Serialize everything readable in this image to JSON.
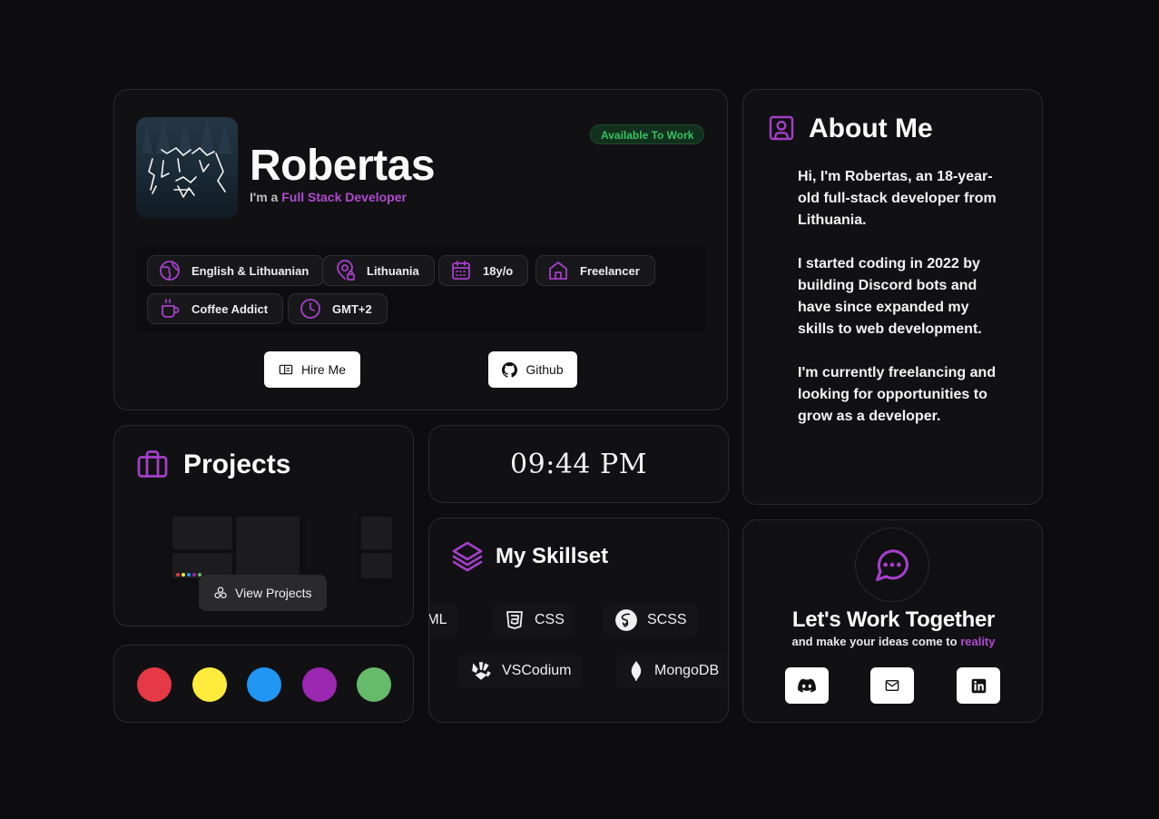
{
  "profile": {
    "name": "Robertas",
    "role_prefix": "I'm a",
    "role": "Full Stack Developer",
    "status_badge": "Available To Work",
    "tags": [
      {
        "label": "English & Lithuanian",
        "icon": "globe-icon"
      },
      {
        "label": "Lithuania",
        "icon": "map-pin-icon"
      },
      {
        "label": "18y/o",
        "icon": "calendar-icon"
      },
      {
        "label": "Freelancer",
        "icon": "home-icon"
      },
      {
        "label": "Coffee Addict",
        "icon": "coffee-icon"
      },
      {
        "label": "GMT+2",
        "icon": "clock-icon"
      }
    ],
    "hire_label": "Hire Me",
    "github_label": "Github"
  },
  "about": {
    "title": "About Me",
    "paragraphs": [
      "Hi, I'm Robertas, an 18-year-old full-stack developer from Lithuania.",
      "I started coding in 2022 by building Discord bots and have since expanded my skills to web development.",
      "I'm currently freelancing and looking for opportunities to grow as a developer."
    ]
  },
  "projects": {
    "title": "Projects",
    "view_label": "View Projects"
  },
  "clock": {
    "time": "09:44 PM"
  },
  "colors": [
    "#e63946",
    "#ffeb3b",
    "#2196f3",
    "#9c27b0",
    "#66bb6a"
  ],
  "skills": {
    "title": "My Skillset",
    "row1": [
      "HTML",
      "CSS",
      "SCSS"
    ],
    "row2": [
      "VSCodium",
      "MongoDB"
    ]
  },
  "contact": {
    "title": "Let's Work Together",
    "subtitle_prefix": "and make your ideas come to",
    "subtitle_accent": "reality",
    "socials": [
      "discord-icon",
      "mail-icon",
      "linkedin-icon"
    ]
  },
  "accent_color": "#b14ad1"
}
